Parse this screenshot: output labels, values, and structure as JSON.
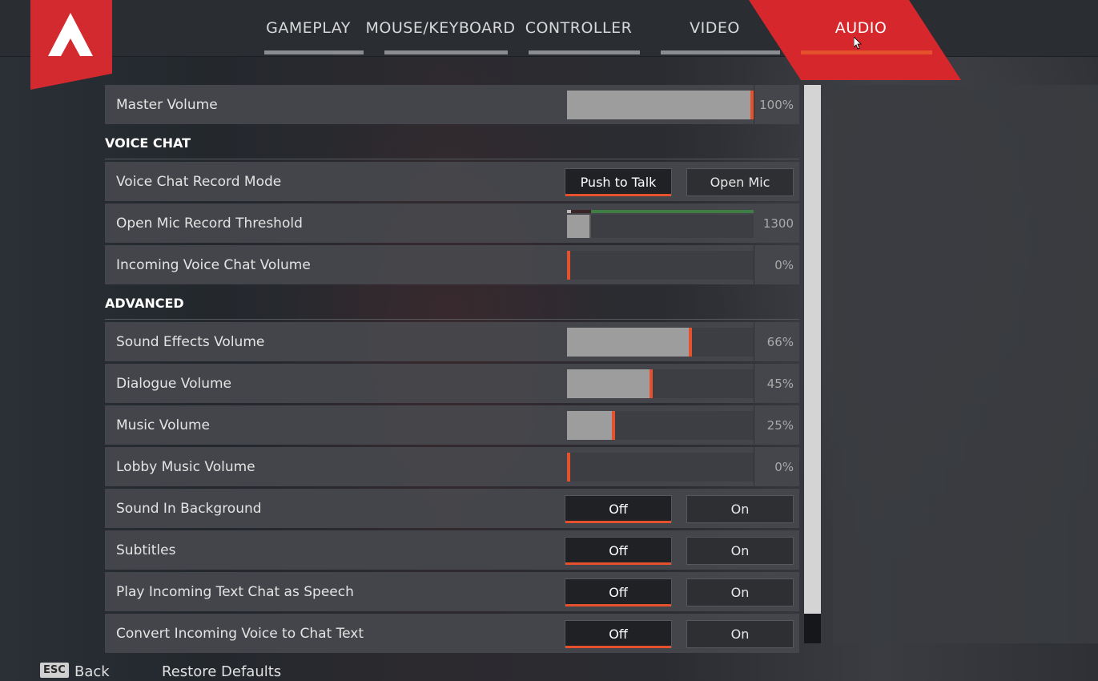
{
  "tabs": [
    {
      "label": "GAMEPLAY",
      "active": false
    },
    {
      "label": "MOUSE/KEYBOARD",
      "active": false
    },
    {
      "label": "CONTROLLER",
      "active": false
    },
    {
      "label": "VIDEO",
      "active": false
    },
    {
      "label": "AUDIO",
      "active": true
    }
  ],
  "colors": {
    "accent": "#e5512c",
    "brand_red": "#d22a2f"
  },
  "master": {
    "label": "Master Volume",
    "value": "100%",
    "level": 1.0
  },
  "voice_chat": {
    "heading": "VOICE CHAT",
    "record_mode": {
      "label": "Voice Chat Record Mode",
      "options": [
        "Push to Talk",
        "Open Mic"
      ],
      "selected": "Push to Talk"
    },
    "threshold": {
      "label": "Open Mic Record Threshold",
      "value": "1300",
      "level": 0.13
    },
    "incoming": {
      "label": "Incoming Voice Chat Volume",
      "value": "0%",
      "level": 0.0
    }
  },
  "advanced": {
    "heading": "ADVANCED",
    "sfx": {
      "label": "Sound Effects Volume",
      "value": "66%",
      "level": 0.66
    },
    "dialogue": {
      "label": "Dialogue Volume",
      "value": "45%",
      "level": 0.45
    },
    "music": {
      "label": "Music Volume",
      "value": "25%",
      "level": 0.25
    },
    "lobby": {
      "label": "Lobby Music Volume",
      "value": "0%",
      "level": 0.0
    },
    "background": {
      "label": "Sound In Background",
      "off": "Off",
      "on": "On",
      "selected": "Off"
    },
    "subtitles": {
      "label": "Subtitles",
      "off": "Off",
      "on": "On",
      "selected": "Off"
    },
    "speech": {
      "label": "Play Incoming Text Chat as Speech",
      "off": "Off",
      "on": "On",
      "selected": "Off"
    },
    "convert": {
      "label": "Convert Incoming Voice to Chat Text",
      "off": "Off",
      "on": "On",
      "selected": "Off"
    }
  },
  "footer": {
    "esc_key": "ESC",
    "back": "Back",
    "restore": "Restore Defaults"
  },
  "icons": {
    "logo": "apex-logo-icon",
    "cursor": "mouse-cursor-icon"
  }
}
